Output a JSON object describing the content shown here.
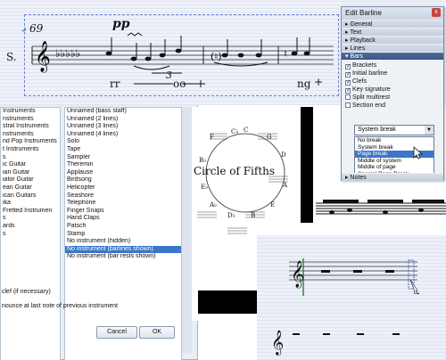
{
  "score": {
    "bar_number": "69",
    "dynamic": "pp",
    "staff_label": "S.",
    "tuplet": "3",
    "text_rr": "rr",
    "text_oo": "oo",
    "text_ng": "ng"
  },
  "instrument_dialog": {
    "left_list": [
      "Instruments",
      "nstruments",
      "stral Instruments",
      "nstruments",
      "nd Pop Instruments",
      "t Instruments",
      "",
      "s",
      "ic Guitar",
      "ian Guitar",
      "iator Guitar",
      "ean Guitar",
      "ican Guitars",
      "",
      "ika",
      "Fretted Instrumen",
      "s",
      "ards",
      "s",
      ""
    ],
    "left_selected_index": 19,
    "right_list": [
      "Unnamed (bass staff)",
      "Unnamed (2 lines)",
      "Unnamed (3 lines)",
      "Unnamed (4 lines)",
      "Solo",
      "Tape",
      "Sampler",
      "Theremin",
      "Applause",
      "Birdsong",
      "Helicopter",
      "Seashore",
      "Telephone",
      "Finger Snaps",
      "Hand Claps",
      "Patsch",
      "Stamp",
      "No instrument (hidden)",
      "No instrument (barlines shown)",
      "No instrument (bar rests shown)"
    ],
    "right_selected_index": 18,
    "option1": "clef (if necessary)",
    "option2": "nounce at last note of previous instrument",
    "cancel_label": "Cancel",
    "ok_label": "OK"
  },
  "circle_of_fifths": {
    "title": "Circle of Fifths",
    "keys": [
      "C",
      "G",
      "D",
      "A",
      "E",
      "B",
      "F",
      "B♭",
      "E♭",
      "A♭",
      "D♭",
      "C♭"
    ]
  },
  "edit_barline": {
    "title": "Edit Barline",
    "close_label": "x",
    "sections": [
      "General",
      "Text",
      "Playback",
      "Lines",
      "Bars"
    ],
    "open_section": "Bars",
    "checkboxes": [
      {
        "label": "Brackets",
        "checked": true
      },
      {
        "label": "Initial barline",
        "checked": true
      },
      {
        "label": "Clefs",
        "checked": true
      },
      {
        "label": "Key signature",
        "checked": true
      },
      {
        "label": "Split multirest",
        "checked": false
      },
      {
        "label": "Section end",
        "checked": false
      }
    ],
    "dropdown_value": "System break",
    "dropdown_options": [
      "No break",
      "System break",
      "Page break",
      "Middle of system",
      "Middle of page",
      "Special Page Break"
    ],
    "dropdown_selected_index": 2,
    "next_section": "Notes"
  }
}
